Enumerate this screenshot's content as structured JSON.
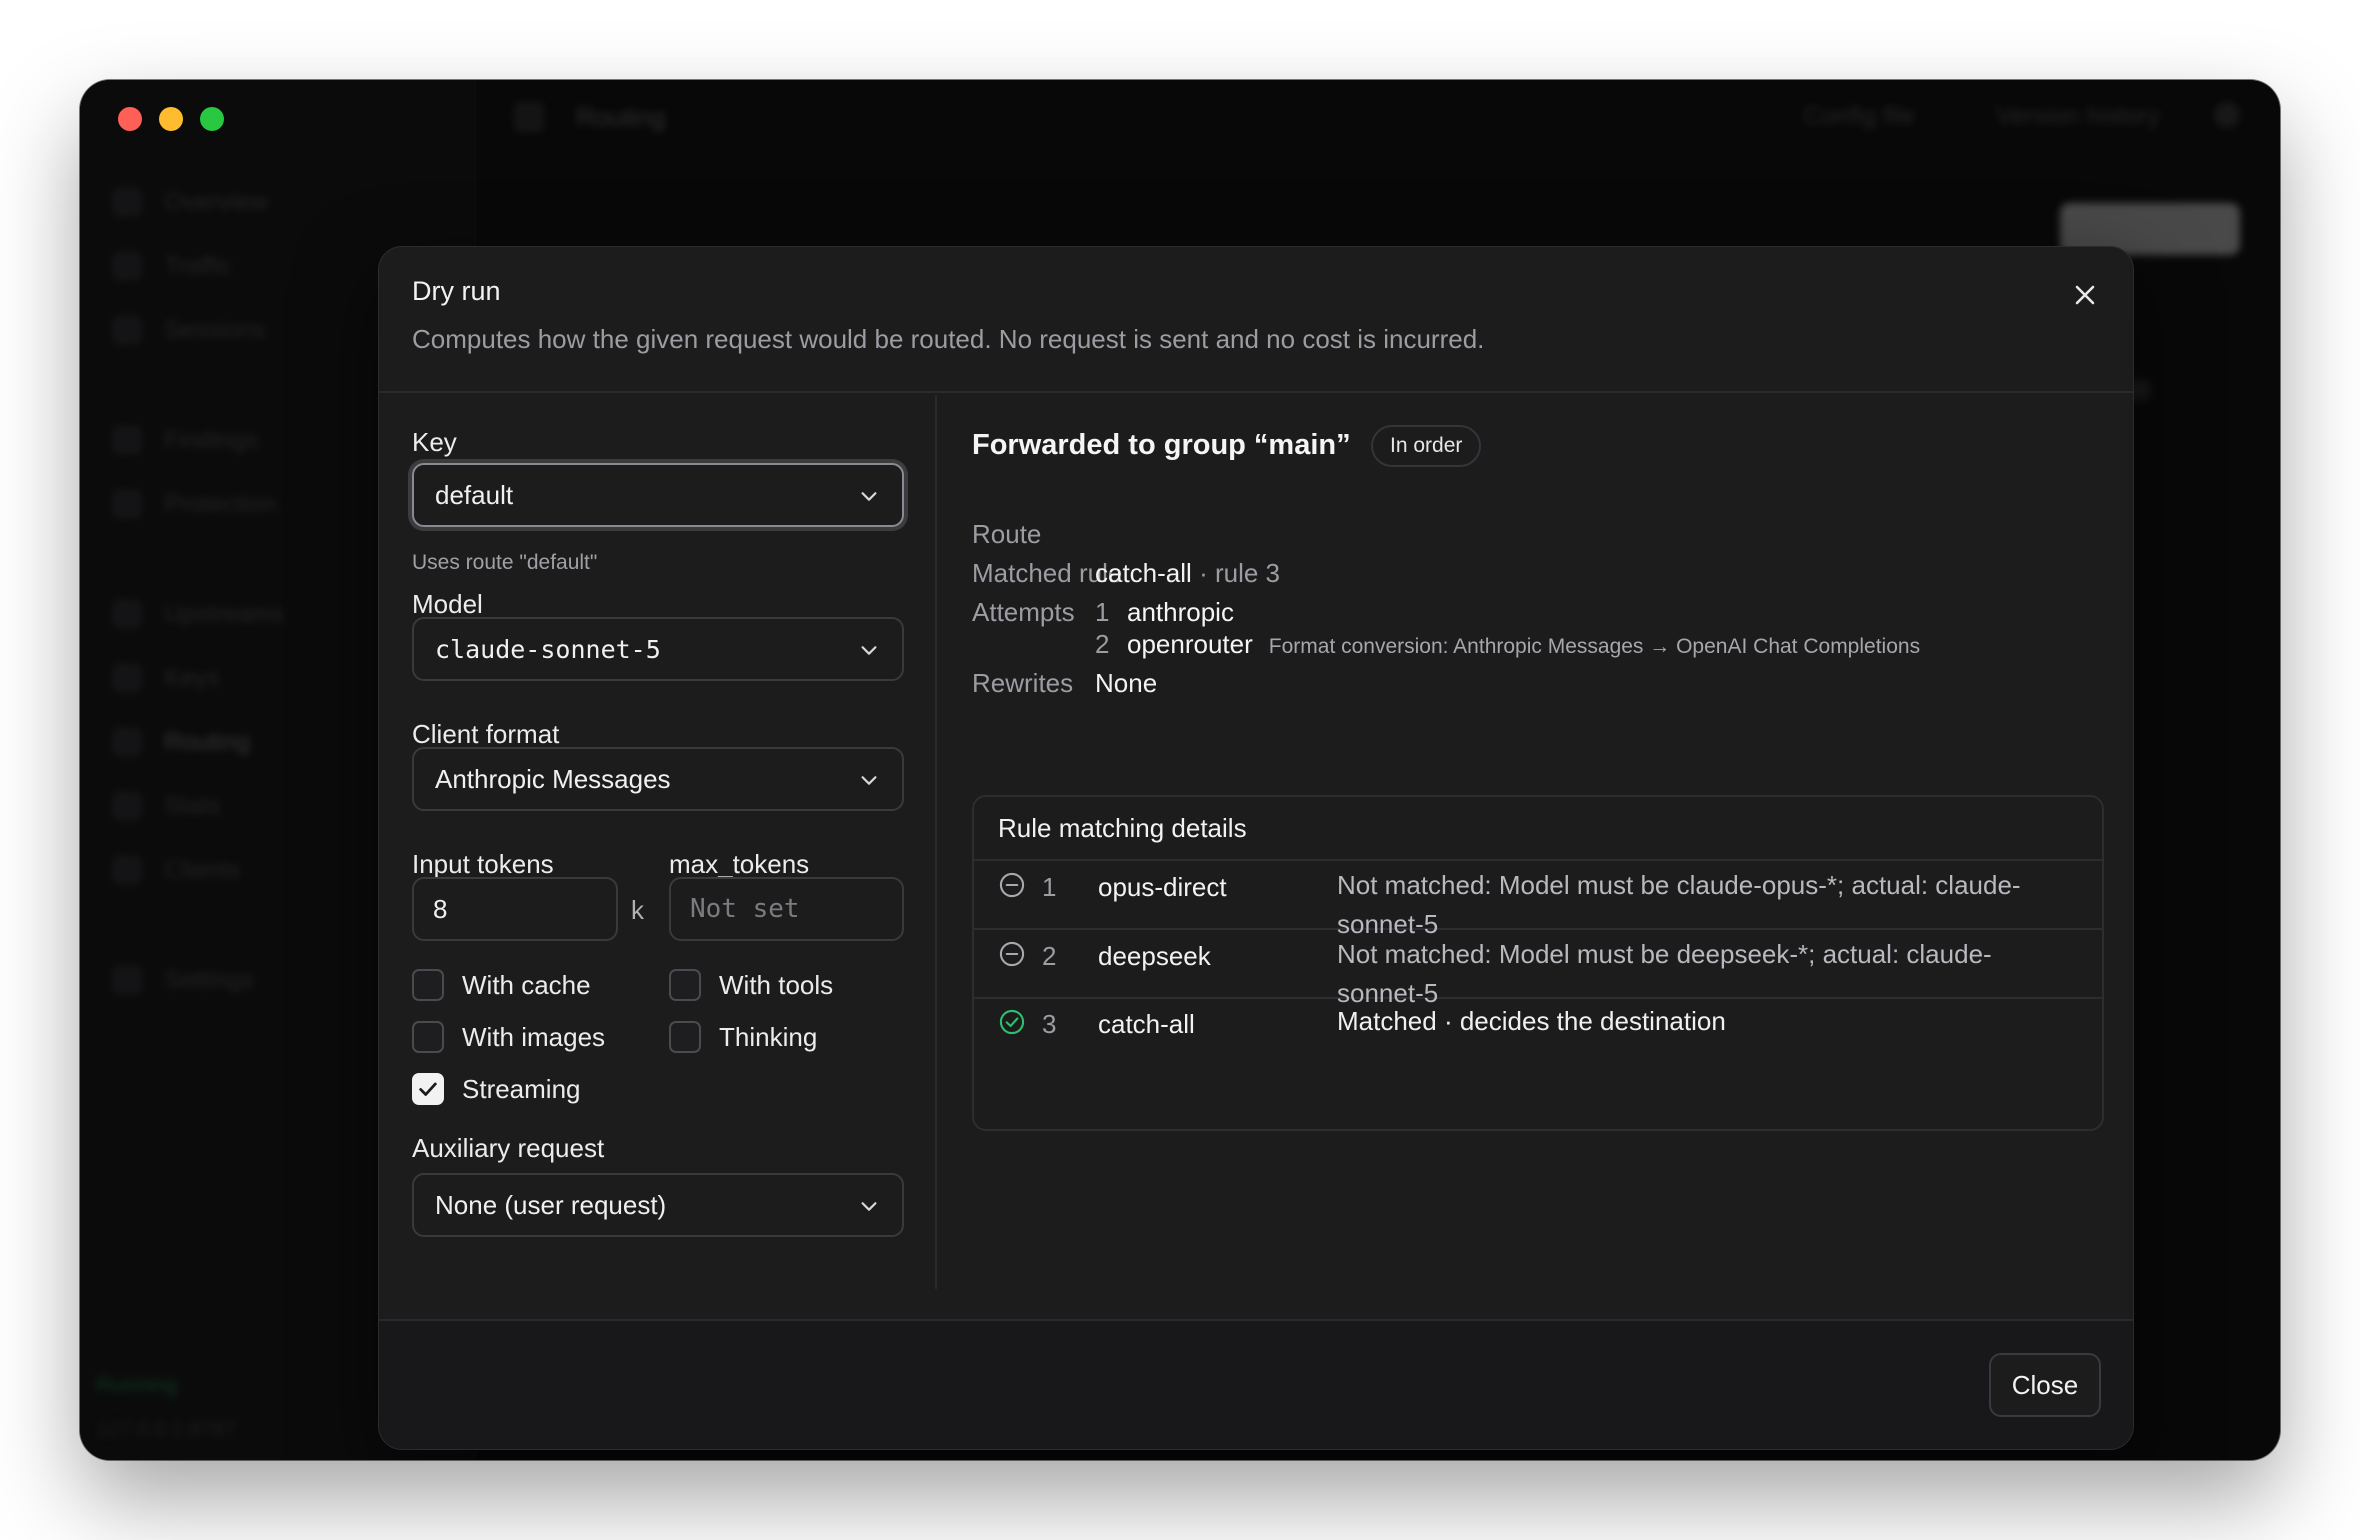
{
  "background": {
    "sidebar_items": [
      "Overview",
      "Traffic",
      "Sessions",
      "Findings",
      "Protection",
      "Upstreams",
      "Keys",
      "Routing",
      "Stats",
      "Clients",
      "Settings"
    ],
    "sidebar_active": "Routing",
    "status_text": "Running",
    "version_text": "127.0.0.1:8787",
    "topbar_title": "Routing",
    "topbar_links": [
      "Config file",
      "Version history"
    ],
    "new_button_label": "New route"
  },
  "dialog": {
    "title": "Dry run",
    "subtitle": "Computes how the given request would be routed. No request is sent and no cost is incurred.",
    "form": {
      "key_label": "Key",
      "key_value": "default",
      "key_hint": "Uses route \"default\"",
      "model_label": "Model",
      "model_value": "claude-sonnet-5",
      "client_format_label": "Client format",
      "client_format_value": "Anthropic Messages",
      "input_tokens_label": "Input tokens",
      "input_tokens_value": "8",
      "input_tokens_unit": "k",
      "max_tokens_label": "max_tokens",
      "max_tokens_placeholder": "Not set",
      "options": [
        {
          "label": "With cache",
          "checked": false
        },
        {
          "label": "With tools",
          "checked": false
        },
        {
          "label": "With images",
          "checked": false
        },
        {
          "label": "Thinking",
          "checked": false
        },
        {
          "label": "Streaming",
          "checked": true
        }
      ],
      "auxiliary_label": "Auxiliary request",
      "auxiliary_value": "None (user request)"
    },
    "result": {
      "title": "Forwarded to group “main”",
      "badge": "In order",
      "route_label": "Route",
      "matched_rule_label": "Matched rule",
      "matched_rule_name": "catch-all",
      "matched_rule_suffix": "· rule 3",
      "attempts_label": "Attempts",
      "attempts": [
        {
          "n": "1",
          "provider": "anthropic",
          "note": ""
        },
        {
          "n": "2",
          "provider": "openrouter",
          "note": "Format conversion: Anthropic Messages → OpenAI Chat Completions"
        }
      ],
      "rewrites_label": "Rewrites",
      "rewrites_value": "None",
      "rules_title": "Rule matching details",
      "rules": [
        {
          "n": "1",
          "name": "opus-direct",
          "status": "not-matched",
          "desc_line1": "Not matched: Model must be claude-opus-*; actual: claude-",
          "desc_line2": "sonnet-5"
        },
        {
          "n": "2",
          "name": "deepseek",
          "status": "not-matched",
          "desc_line1": "Not matched: Model must be deepseek-*; actual: claude-",
          "desc_line2": "sonnet-5"
        },
        {
          "n": "3",
          "name": "catch-all",
          "status": "matched",
          "desc_line1": "Matched · decides the destination",
          "desc_line2": ""
        }
      ]
    },
    "close_label": "Close"
  },
  "colors": {
    "matched": "#2fbf71",
    "not_matched": "#9c9ca2",
    "traffic_red": "#fe5f57",
    "traffic_yellow": "#febc2e",
    "traffic_green": "#28c840"
  }
}
